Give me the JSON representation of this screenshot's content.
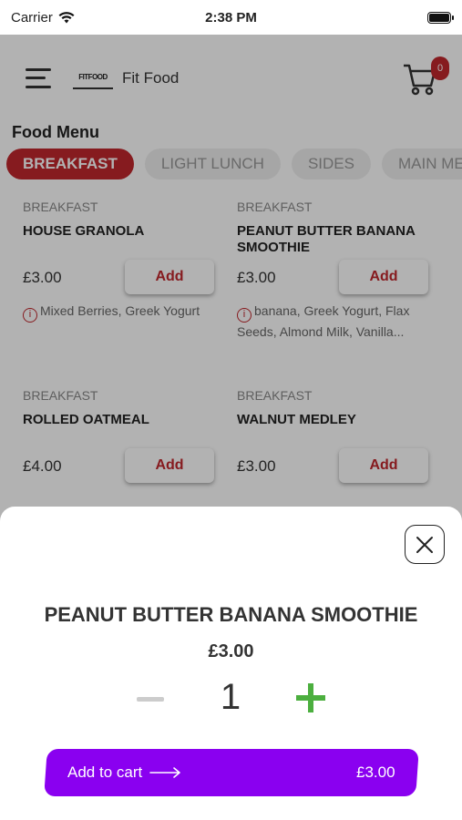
{
  "status_bar": {
    "carrier": "Carrier",
    "time": "2:38 PM"
  },
  "header": {
    "logo_text": "FITFOOD",
    "brand": "Fit Food",
    "cart_count": "0"
  },
  "menu": {
    "title": "Food Menu",
    "tabs": [
      {
        "label": "BREAKFAST",
        "active": true
      },
      {
        "label": "LIGHT LUNCH",
        "active": false
      },
      {
        "label": "SIDES",
        "active": false
      },
      {
        "label": "MAIN MEALS",
        "active": false
      }
    ],
    "items": [
      {
        "category": "BREAKFAST",
        "name": "HOUSE GRANOLA",
        "price": "£3.00",
        "add_label": "Add",
        "ingredients": "Mixed Berries, Greek Yogurt"
      },
      {
        "category": "BREAKFAST",
        "name": "PEANUT BUTTER BANANA SMOOTHIE",
        "price": "£3.00",
        "add_label": "Add",
        "ingredients": "banana, Greek Yogurt, Flax Seeds, Almond Milk, Vanilla..."
      },
      {
        "category": "BREAKFAST",
        "name": "ROLLED OATMEAL",
        "price": "£4.00",
        "add_label": "Add",
        "ingredients": ""
      },
      {
        "category": "BREAKFAST",
        "name": "WALNUT MEDLEY",
        "price": "£3.00",
        "add_label": "Add",
        "ingredients": ""
      }
    ]
  },
  "sheet": {
    "title": "PEANUT BUTTER BANANA SMOOTHIE",
    "price": "£3.00",
    "quantity": "1",
    "cta_label": "Add to cart",
    "cta_total": "£3.00"
  },
  "colors": {
    "accent_red": "#c0272d",
    "cta_purple": "#8a00f0",
    "plus_green": "#4caf3f"
  }
}
